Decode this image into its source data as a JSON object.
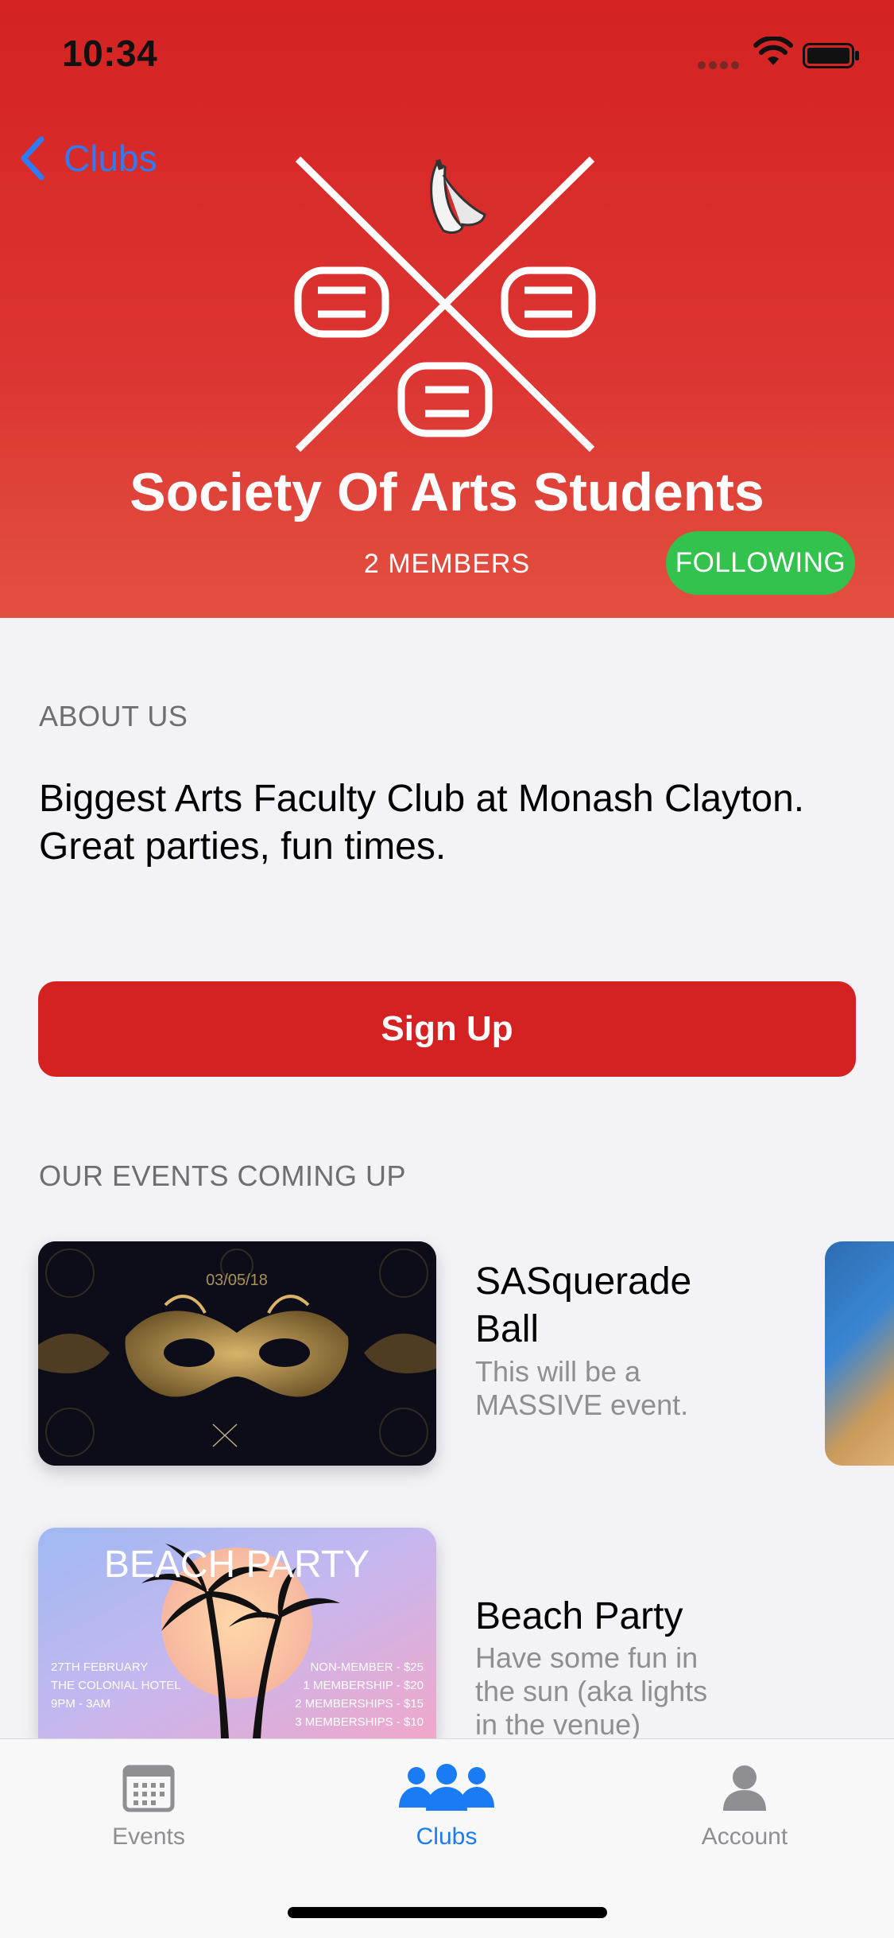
{
  "status_bar": {
    "time": "10:34"
  },
  "nav": {
    "back_label": "Clubs"
  },
  "club": {
    "name": "Society Of Arts Students",
    "members": "2 MEMBERS",
    "following_label": "FOLLOWING"
  },
  "about": {
    "heading": "ABOUT US",
    "text": "Biggest Arts Faculty Club at Monash Clayton. Great parties, fun times."
  },
  "signup": {
    "label": "Sign Up"
  },
  "events": {
    "heading": "OUR EVENTS COMING UP",
    "items": [
      {
        "title": "SASquerade Ball",
        "description": "This will be a MASSIVE event.",
        "poster_date": "03/05/18"
      },
      {
        "title": "Beach Party",
        "description": "Have some fun in the sun (aka lights in the venue)",
        "poster_title": "BEACH PARTY",
        "poster_info_left": [
          "27TH FEBRUARY",
          "THE COLONIAL HOTEL",
          "9PM - 3AM"
        ],
        "poster_info_right": [
          "NON-MEMBER - $25",
          "1 MEMBERSHIP - $20",
          "2 MEMBERSHIPS - $15",
          "3 MEMBERSHIPS - $10"
        ]
      }
    ]
  },
  "tabbar": {
    "items": [
      {
        "label": "Events",
        "icon": "calendar-icon",
        "active": false
      },
      {
        "label": "Clubs",
        "icon": "people-icon",
        "active": true
      },
      {
        "label": "Account",
        "icon": "person-icon",
        "active": false
      }
    ],
    "active_color": "#1a7cf5",
    "inactive_color": "#8e8e93"
  },
  "colors": {
    "brand_red": "#d42222",
    "following_green": "#33c24d",
    "link_blue": "#2f7bf6"
  }
}
